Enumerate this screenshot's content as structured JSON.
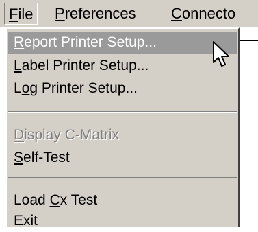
{
  "menubar": {
    "items": [
      {
        "label": "File",
        "mnemonic": "F",
        "rest": "ile"
      },
      {
        "label": "Preferences",
        "mnemonic": "P",
        "rest": "references"
      },
      {
        "label": "Connecto",
        "mnemonic": "C",
        "rest": "onnecto"
      }
    ]
  },
  "file_menu": {
    "items": [
      {
        "pre": "",
        "mnemonic": "R",
        "post": "eport Printer Setup...",
        "state": "highlighted"
      },
      {
        "pre": "",
        "mnemonic": "L",
        "post": "abel Printer Setup...",
        "state": "enabled"
      },
      {
        "pre": "L",
        "mnemonic": "o",
        "post": "g Printer Setup...",
        "state": "enabled"
      },
      {
        "pre": "",
        "mnemonic": "D",
        "post": "isplay C-Matrix",
        "state": "disabled"
      },
      {
        "pre": "",
        "mnemonic": "S",
        "post": "elf-Test",
        "state": "enabled"
      },
      {
        "pre": "Load ",
        "mnemonic": "C",
        "post": "x Test",
        "state": "enabled"
      },
      {
        "pre": "Exit",
        "mnemonic": "",
        "post": "",
        "state": "enabled"
      }
    ]
  },
  "colors": {
    "menu_background": "#d4d0c8",
    "highlight_background": "#9a9a9a",
    "disabled_text": "#808080"
  },
  "icons": {
    "cursor": "arrow-pointer-icon"
  }
}
